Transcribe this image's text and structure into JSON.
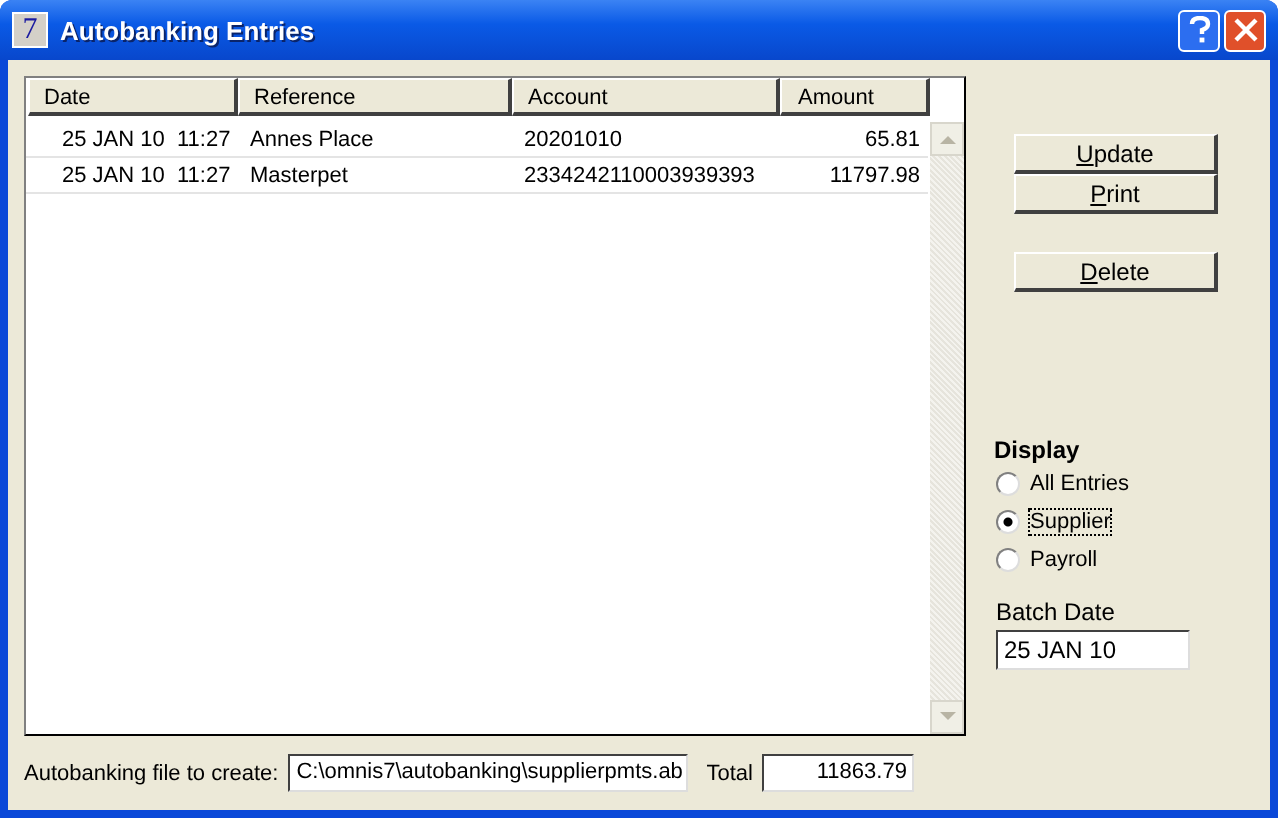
{
  "window": {
    "title": "Autobanking Entries",
    "icon_text": "7"
  },
  "table": {
    "columns": [
      "Date",
      "Reference",
      "Account",
      "Amount"
    ],
    "rows": [
      {
        "date": "25 JAN 10  11:27",
        "reference": "Annes Place",
        "account": "20201010",
        "amount": "65.81"
      },
      {
        "date": "25 JAN 10  11:27",
        "reference": "Masterpet",
        "account": "2334242110003939393",
        "amount": "11797.98"
      }
    ]
  },
  "buttons": [
    {
      "label": "Update"
    },
    {
      "label": "Print"
    },
    {
      "label": "Delete"
    }
  ],
  "display": {
    "title": "Display",
    "options": [
      {
        "label": "All Entries",
        "selected": false
      },
      {
        "label": "Supplier",
        "selected": true
      },
      {
        "label": "Payroll",
        "selected": false
      }
    ]
  },
  "batch_date": {
    "label": "Batch Date",
    "value": "25 JAN 10"
  },
  "file": {
    "label": "Autobanking file to create:",
    "value": "C:\\omnis7\\autobanking\\supplierpmts.ab"
  },
  "total": {
    "label": "Total",
    "value": "11863.79"
  }
}
